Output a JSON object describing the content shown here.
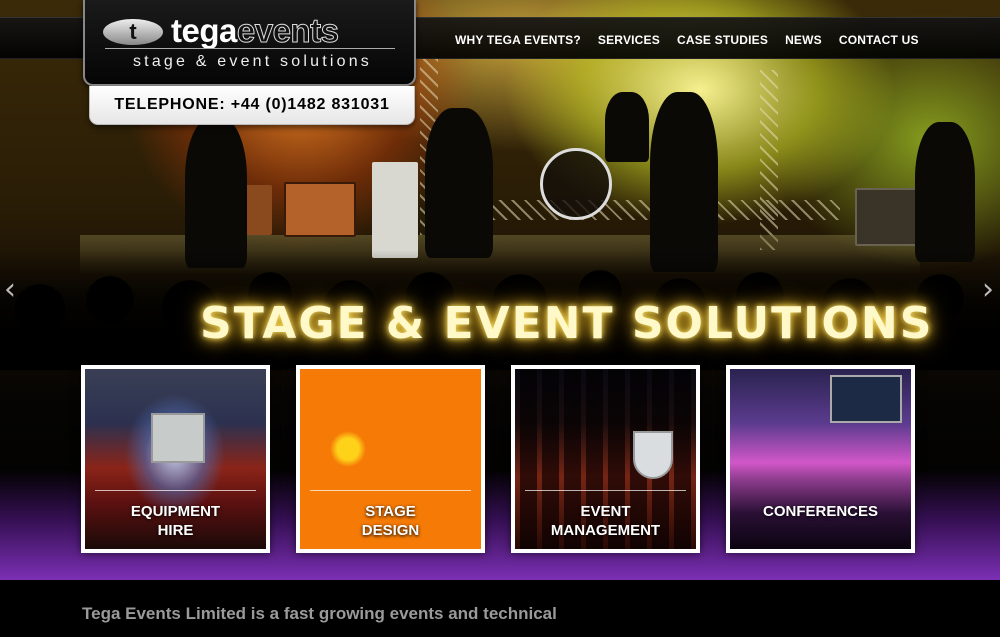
{
  "brand": {
    "logo_mark": "t",
    "logo_word_1": "tega",
    "logo_word_2": "events",
    "tagline": "stage & event solutions",
    "telephone": "TELEPHONE: +44 (0)1482 831031"
  },
  "nav": {
    "items": [
      {
        "label": "WHY TEGA EVENTS?"
      },
      {
        "label": "SERVICES"
      },
      {
        "label": "CASE STUDIES"
      },
      {
        "label": "NEWS"
      },
      {
        "label": "CONTACT US"
      }
    ]
  },
  "slider": {
    "prev_icon": "chevron-left-icon",
    "next_icon": "chevron-right-icon",
    "prev_glyph": "‹",
    "next_glyph": "›"
  },
  "hero": {
    "headline": "STAGE & EVENT SOLUTIONS"
  },
  "services": {
    "tiles": [
      {
        "line1": "EQUIPMENT",
        "line2": "HIRE"
      },
      {
        "line1": "STAGE",
        "line2": "DESIGN"
      },
      {
        "line1": "EVENT",
        "line2": "MANAGEMENT"
      },
      {
        "line1": "CONFERENCES",
        "line2": ""
      }
    ]
  },
  "intro": {
    "text": "Tega Events Limited is a fast growing events and technical"
  },
  "colors": {
    "headline_glow": "#ffe66a",
    "accent_purple": "#8232be",
    "intro_text": "#9a9a9a"
  }
}
